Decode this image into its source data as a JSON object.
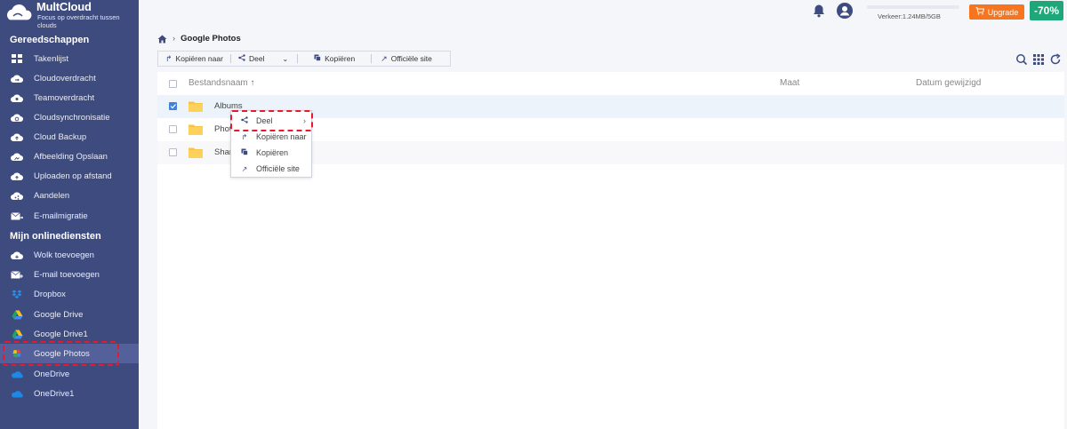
{
  "brand": {
    "name": "MultCloud",
    "tagline": "Focus op overdracht tussen clouds"
  },
  "sidebar": {
    "tools_title": "Gereedschappen",
    "tools": [
      {
        "label": "Takenlijst",
        "icon": "grid-icon"
      },
      {
        "label": "Cloudoverdracht",
        "icon": "cloud-transfer-icon"
      },
      {
        "label": "Teamoverdracht",
        "icon": "cloud-team-icon"
      },
      {
        "label": "Cloudsynchronisatie",
        "icon": "cloud-sync-icon"
      },
      {
        "label": "Cloud Backup",
        "icon": "cloud-backup-icon"
      },
      {
        "label": "Afbeelding Opslaan",
        "icon": "cloud-image-icon"
      },
      {
        "label": "Uploaden op afstand",
        "icon": "cloud-upload-icon"
      },
      {
        "label": "Aandelen",
        "icon": "cloud-share-icon"
      },
      {
        "label": "E-mailmigratie",
        "icon": "email-migration-icon"
      }
    ],
    "services_title": "Mijn onlinediensten",
    "services": [
      {
        "label": "Wolk toevoegen",
        "icon": "add-cloud-icon"
      },
      {
        "label": "E-mail toevoegen",
        "icon": "add-email-icon"
      },
      {
        "label": "Dropbox",
        "icon": "dropbox-icon"
      },
      {
        "label": "Google Drive",
        "icon": "google-drive-icon"
      },
      {
        "label": "Google Drive1",
        "icon": "google-drive-icon"
      },
      {
        "label": "Google Photos",
        "icon": "google-photos-icon",
        "active": true
      },
      {
        "label": "OneDrive",
        "icon": "onedrive-icon"
      },
      {
        "label": "OneDrive1",
        "icon": "onedrive-icon"
      }
    ]
  },
  "topbar": {
    "traffic_label": "Verkeer:1.24MB/5GB",
    "upgrade_label": "Upgrade",
    "promo_label": "-70%"
  },
  "breadcrumb": {
    "current": "Google Photos"
  },
  "toolbar": {
    "copy_to": "Kopiëren naar",
    "share": "Deel",
    "copy": "Kopiëren",
    "official_site": "Officiële site"
  },
  "table": {
    "columns": {
      "name": "Bestandsnaam",
      "size": "Maat",
      "date": "Datum gewijzigd"
    },
    "rows": [
      {
        "name": "Albums",
        "checked": true
      },
      {
        "name": "Photos",
        "checked": false
      },
      {
        "name": "Shared",
        "checked": false
      }
    ]
  },
  "context_menu": {
    "items": [
      "Deel",
      "Kopiëren naar",
      "Kopiëren",
      "Officiële site"
    ]
  },
  "colors": {
    "sidebar": "#3e4b7e",
    "accent_orange": "#f7751f",
    "highlight_red": "#e8192c",
    "promo_green": "#1ea87a"
  }
}
